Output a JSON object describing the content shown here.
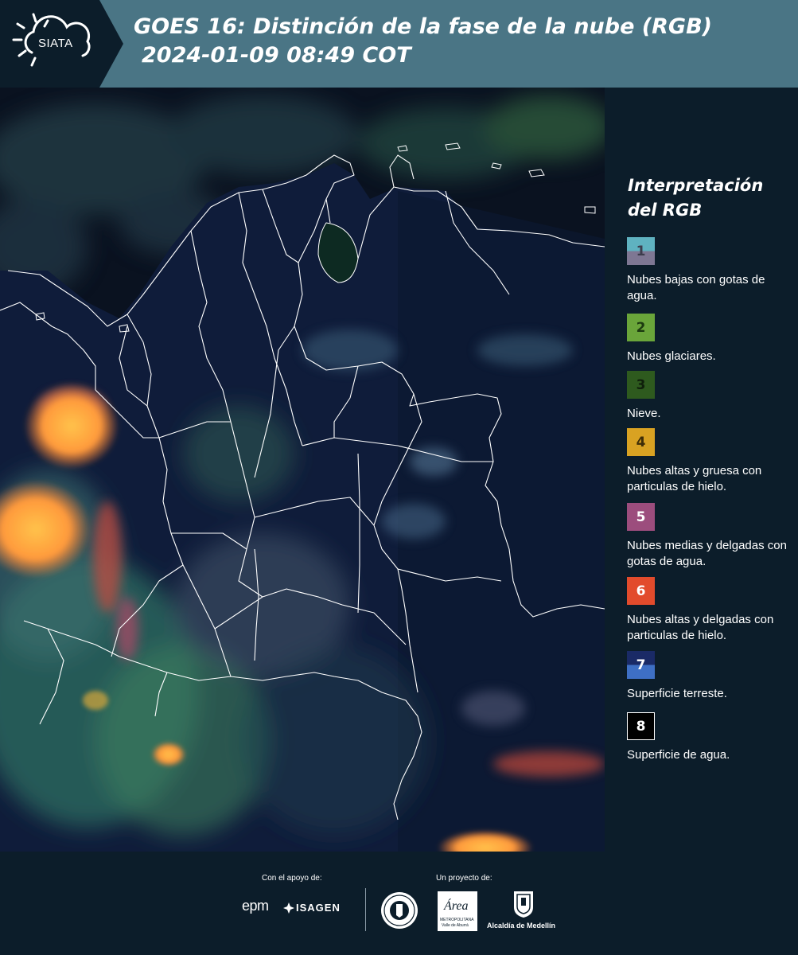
{
  "header": {
    "logo_text": "SIATA",
    "title_line1": "GOES 16: Distinción de la fase de la nube (RGB)",
    "title_line2": "2024-01-09 08:49 COT"
  },
  "legend": {
    "title": "Interpretación del RGB",
    "items": [
      {
        "number": "1",
        "label": "Nubes bajas con gotas de agua.",
        "color_top": "#5fb2c0",
        "color_bottom": "#7e7793",
        "num_color": "#3d3d4d"
      },
      {
        "number": "2",
        "label": "Nubes glaciares.",
        "color_top": "#6aa53a",
        "color_bottom": "#6aa53a",
        "num_color": "#1c3a10"
      },
      {
        "number": "3",
        "label": "Nieve.",
        "color_top": "#2e5a1e",
        "color_bottom": "#2e5a1e",
        "num_color": "#0f200b"
      },
      {
        "number": "4",
        "label": "Nubes altas y gruesa con particulas de hielo.",
        "color_top": "#d9a222",
        "color_bottom": "#d9a222",
        "num_color": "#3d2d08"
      },
      {
        "number": "5",
        "label": "Nubes medias y delgadas con gotas de agua.",
        "color_top": "#9c4d7d",
        "color_bottom": "#9c4d7d",
        "num_color": "#ffffff"
      },
      {
        "number": "6",
        "label": "Nubes altas y delgadas con particulas de hielo.",
        "color_top": "#e24b2c",
        "color_bottom": "#e24b2c",
        "num_color": "#ffffff"
      },
      {
        "number": "7",
        "label": "Superficie terreste.",
        "color_top": "#1a2a66",
        "color_bottom": "#3e6fc4",
        "num_color": "#ffffff"
      },
      {
        "number": "8",
        "label": "Superficie de agua.",
        "color_top": "#000000",
        "color_bottom": "#000000",
        "num_color": "#ffffff"
      }
    ]
  },
  "footer": {
    "support_label": "Con el apoyo de:",
    "project_label": "Un proyecto de:",
    "sponsor_epm": "epm",
    "sponsor_isagen": "ISAGEN",
    "partner_area": "Área",
    "partner_area_sub": "METROPOLITANA",
    "partner_area_sub2": "Valle de Aburrá",
    "partner_alcaldia": "Alcaldía de Medellín"
  },
  "colors": {
    "header_bg": "#4a7585",
    "panel_bg": "#0c1d2a",
    "map_land": "#0f1c3a",
    "cloud_orange": "#ff9a3c",
    "border_white": "#ffffff"
  }
}
